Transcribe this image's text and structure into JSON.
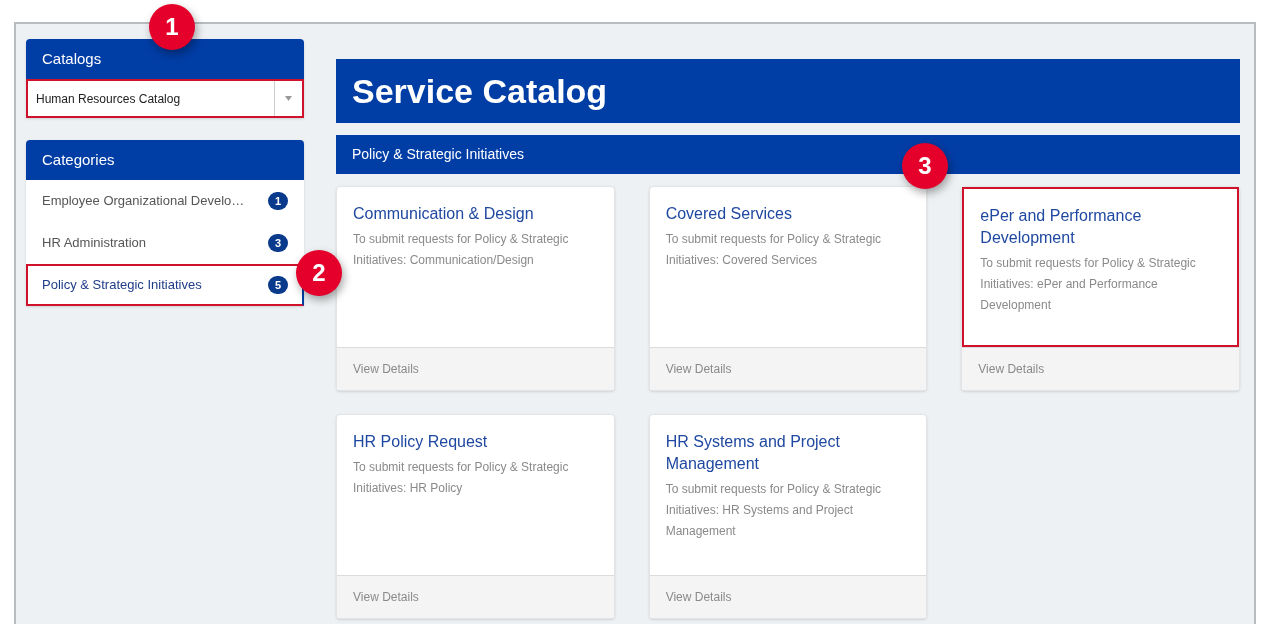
{
  "catalogs": {
    "title": "Catalogs",
    "select": {
      "value": "Human Resources Catalog",
      "highlighted": true
    }
  },
  "categories": {
    "title": "Categories",
    "items": [
      {
        "label": "Employee Organizational Develo…",
        "count": "1",
        "selected": false,
        "highlighted": false
      },
      {
        "label": "HR Administration",
        "count": "3",
        "selected": false,
        "highlighted": false
      },
      {
        "label": "Policy & Strategic Initiatives",
        "count": "5",
        "selected": true,
        "highlighted": true
      }
    ]
  },
  "page_title": "Service Catalog",
  "section_title": "Policy & Strategic Initiatives",
  "cards": [
    {
      "title": "Communication & Design",
      "description": "To submit requests for Policy & Strategic Initiatives: Communication/Design",
      "link": "View Details",
      "highlighted": false
    },
    {
      "title": "Covered Services",
      "description": "To submit requests for Policy & Strategic Initiatives: Covered Services",
      "link": "View Details",
      "highlighted": false
    },
    {
      "title": "ePer and Performance Development",
      "description": "To submit requests for Policy & Strategic Initiatives: ePer and Performance Development",
      "link": "View Details",
      "highlighted": true
    },
    {
      "title": "HR Policy Request",
      "description": "To submit requests for Policy & Strategic Initiatives: HR Policy",
      "link": "View Details",
      "highlighted": false
    },
    {
      "title": "HR Systems and Project Management",
      "description": "To submit requests for Policy & Strategic Initiatives: HR Systems and Project Management",
      "link": "View Details",
      "highlighted": false
    }
  ],
  "callouts": [
    "1",
    "2",
    "3"
  ]
}
